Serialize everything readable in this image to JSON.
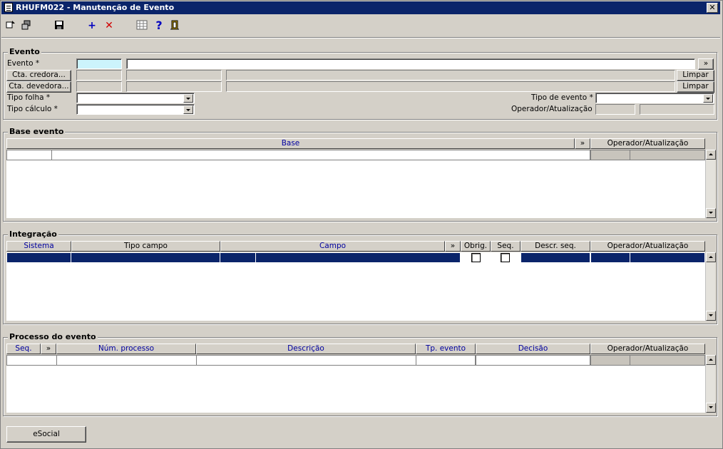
{
  "window": {
    "title": "RHUFM022 - Manutenção de Evento",
    "close_glyph": "✕"
  },
  "toolbar": {
    "icons": [
      "enter-query-icon",
      "execute-query-icon",
      "save-icon",
      "add-icon",
      "delete-icon",
      "calendar-grid-icon",
      "help-icon",
      "exit-icon"
    ],
    "add_glyph": "+",
    "delete_glyph": "✕",
    "help_glyph": "?"
  },
  "evento": {
    "title": "Evento",
    "evento_label": "Evento *",
    "cta_credora_button": "Cta. credora...",
    "cta_devedora_button": "Cta. devedora...",
    "limpar_label": "Limpar",
    "tipo_folha_label": "Tipo folha *",
    "tipo_calculo_label": "Tipo cálculo *",
    "tipo_evento_label": "Tipo de evento *",
    "operador_label": "Operador/Atualização",
    "more_glyph": "»"
  },
  "base_evento": {
    "title": "Base evento",
    "columns": [
      "Base",
      "»",
      "Operador/Atualização"
    ]
  },
  "integracao": {
    "title": "Integração",
    "columns": [
      "Sistema",
      "Tipo campo",
      "Campo",
      "»",
      "Obrig.",
      "Seq.",
      "Descr. seq.",
      "Operador/Atualização"
    ]
  },
  "processo": {
    "title": "Processo do evento",
    "columns": [
      "Seq.",
      "»",
      "Núm. processo",
      "Descrição",
      "Tp. evento",
      "Decisão",
      "Operador/Atualização"
    ]
  },
  "footer": {
    "esocial_button": "eSocial"
  },
  "colors": {
    "titlebar": "#0a246a",
    "face": "#d4d0c8",
    "required_field": "#ccf4fc",
    "header_blue": "#0000a0"
  }
}
